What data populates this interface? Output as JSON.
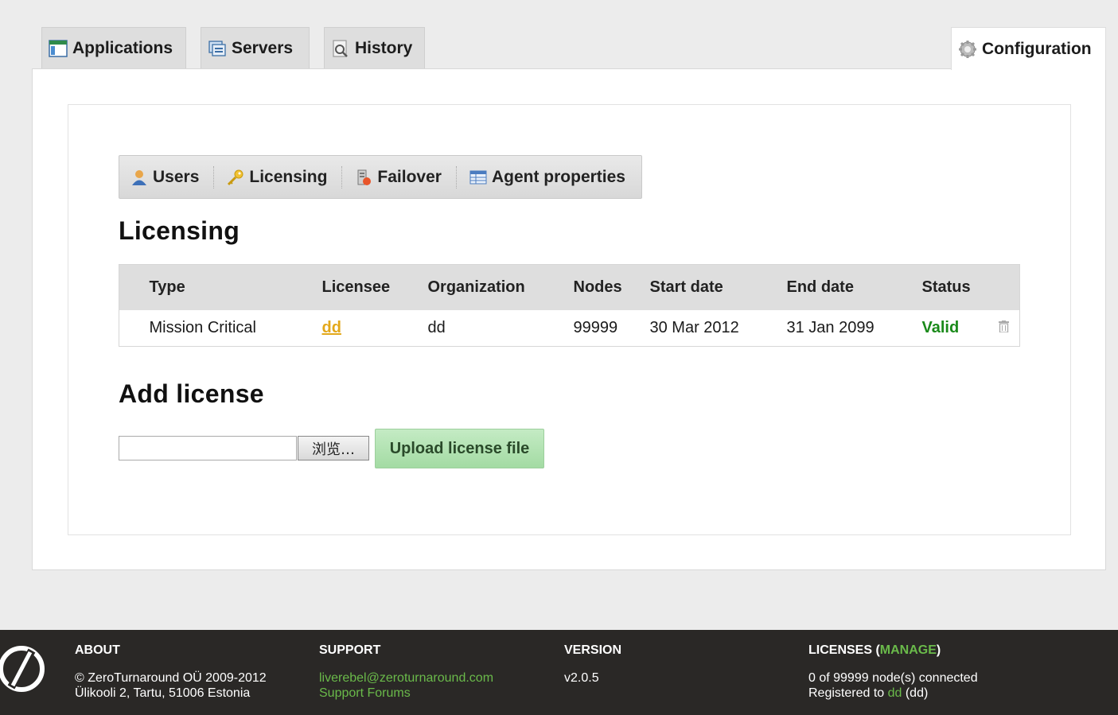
{
  "top_tabs": {
    "applications": "Applications",
    "servers": "Servers",
    "history": "History",
    "configuration": "Configuration"
  },
  "sub_tabs": {
    "users": "Users",
    "licensing": "Licensing",
    "failover": "Failover",
    "agent_properties": "Agent properties"
  },
  "licensing_title": "Licensing",
  "table": {
    "headers": [
      "Type",
      "Licensee",
      "Organization",
      "Nodes",
      "Start date",
      "End date",
      "Status"
    ],
    "row": {
      "type": "Mission Critical",
      "licensee": "dd",
      "organization": "dd",
      "nodes": "99999",
      "start_date": "30 Mar 2012",
      "end_date": "31 Jan 2099",
      "status": "Valid"
    }
  },
  "add_license_title": "Add license",
  "file_input": {
    "browse_label": "浏览…",
    "value": ""
  },
  "upload_button": "Upload license file",
  "footer": {
    "about": {
      "heading": "ABOUT",
      "line1": "© ZeroTurnaround OÜ 2009-2012",
      "line2": "Ülikooli 2, Tartu, 51006 Estonia"
    },
    "support": {
      "heading": "SUPPORT",
      "email": "liverebel@zeroturnaround.com",
      "forums": "Support Forums"
    },
    "version": {
      "heading": "VERSION",
      "value": "v2.0.5"
    },
    "licenses": {
      "heading_prefix": "LICENSES (",
      "manage": "MANAGE",
      "heading_suffix": ")",
      "connected": "0 of 99999 node(s) connected",
      "registered_prefix": "Registered to ",
      "registered_link": "dd",
      "registered_suffix": " (dd)"
    }
  },
  "colors": {
    "valid": "#1a8a1a",
    "link": "#e3a81a",
    "footer_link": "#6aba4a",
    "upload_button": "#a3dba3"
  }
}
